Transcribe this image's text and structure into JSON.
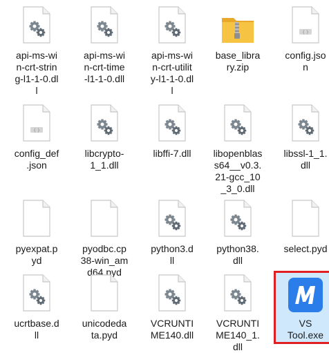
{
  "window": {
    "title": ""
  },
  "files": [
    {
      "name": "api-ms-win-crt-string-l1-1-0.dll",
      "label": "api-ms-wi\nn-crt-strin\ng-l1-1-0.dl\nl",
      "icon": "dll-gear-icon",
      "selected": false
    },
    {
      "name": "api-ms-win-crt-time-l1-1-0.dll",
      "label": "api-ms-wi\nn-crt-time\n-l1-1-0.dll",
      "icon": "dll-gear-icon",
      "selected": false
    },
    {
      "name": "api-ms-win-crt-utility-l1-1-0.dll",
      "label": "api-ms-wi\nn-crt-utilit\ny-l1-1-0.dl\nl",
      "icon": "dll-gear-icon",
      "selected": false
    },
    {
      "name": "base_library.zip",
      "label": "base_libra\nry.zip",
      "icon": "zip-folder-icon",
      "selected": false
    },
    {
      "name": "config.json",
      "label": "config.jso\nn",
      "icon": "json-file-icon",
      "selected": false
    },
    {
      "name": "config_default.json",
      "label": "config_def\n.json",
      "icon": "json-file-icon",
      "selected": false
    },
    {
      "name": "libcrypto-1_1.dll",
      "label": "libcrypto-\n1_1.dll",
      "icon": "dll-gear-icon",
      "selected": false
    },
    {
      "name": "libffi-7.dll",
      "label": "libffi-7.dll",
      "icon": "dll-gear-icon",
      "selected": false
    },
    {
      "name": "libopenblas64__v0.3.21-gcc_10_3_0.dll",
      "label": "libopenblas\ns64__v0.3.\n21-gcc_10\n_3_0.dll",
      "icon": "dll-gear-icon",
      "selected": false
    },
    {
      "name": "libssl-1_1.dll",
      "label": "libssl-1_1.\ndll",
      "icon": "dll-gear-icon",
      "selected": false
    },
    {
      "name": "pyexpat.pyd",
      "label": "pyexpat.p\nyd",
      "icon": "blank-file-icon",
      "selected": false
    },
    {
      "name": "pyodbc.cp38-win_amd64.pyd",
      "label": "pyodbc.cp\n38-win_am\nd64.pyd",
      "icon": "blank-file-icon",
      "selected": false
    },
    {
      "name": "python3.dll",
      "label": "python3.d\nll",
      "icon": "dll-gear-icon",
      "selected": false
    },
    {
      "name": "python38.dll",
      "label": "python38.\ndll",
      "icon": "dll-gear-icon",
      "selected": false
    },
    {
      "name": "select.pyd",
      "label": "select.pyd",
      "icon": "blank-file-icon",
      "selected": false
    },
    {
      "name": "ucrtbase.dll",
      "label": "ucrtbase.d\nll",
      "icon": "dll-gear-icon",
      "selected": false
    },
    {
      "name": "unicodedata.pyd",
      "label": "unicodeda\nta.pyd",
      "icon": "blank-file-icon",
      "selected": false
    },
    {
      "name": "VCRUNTIME140.dll",
      "label": "VCRUNTI\nME140.dll",
      "icon": "dll-gear-icon",
      "selected": false
    },
    {
      "name": "VCRUNTIME140_1.dll",
      "label": "VCRUNTI\nME140_1.\ndll",
      "icon": "dll-gear-icon",
      "selected": false
    },
    {
      "name": "VS Tool.exe",
      "label": "VS\nTool.exe",
      "icon": "vs-tool-app-icon",
      "selected": true
    }
  ],
  "colors": {
    "selection_border": "#e02020",
    "selection_fill": "#cfe8fb",
    "app_icon_blue": "#2b7de9",
    "folder_yellow": "#f6c343"
  }
}
